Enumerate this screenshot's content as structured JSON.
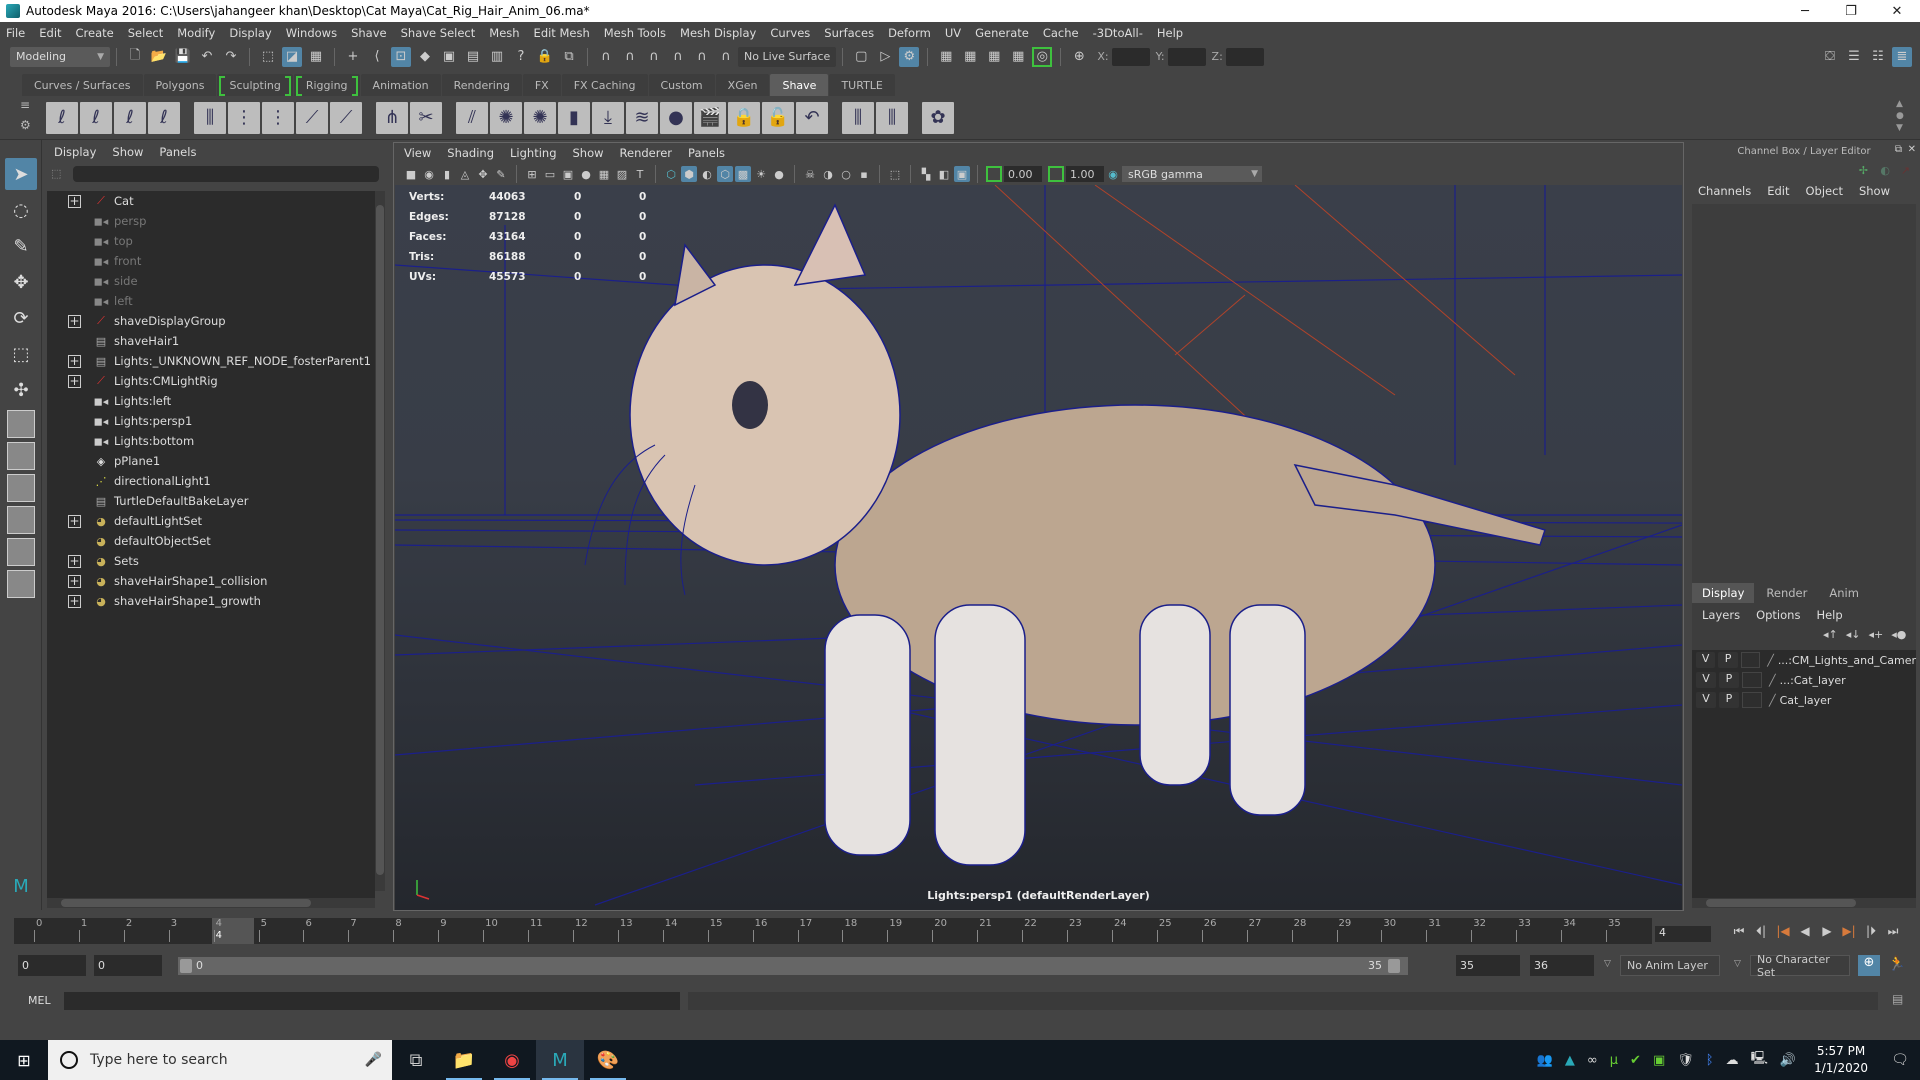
{
  "titlebar": {
    "title": "Autodesk Maya 2016: C:\\Users\\jahangeer khan\\Desktop\\Cat Maya\\Cat_Rig_Hair_Anim_06.ma*",
    "minimize": "─",
    "maximize": "❐",
    "close": "✕"
  },
  "menubar": [
    "File",
    "Edit",
    "Create",
    "Select",
    "Modify",
    "Display",
    "Windows",
    "Shave",
    "Shave Select",
    "Mesh",
    "Edit Mesh",
    "Mesh Tools",
    "Mesh Display",
    "Curves",
    "Surfaces",
    "Deform",
    "UV",
    "Generate",
    "Cache",
    "-3DtoAll-",
    "Help"
  ],
  "statusline": {
    "menuset": "Modeling",
    "live_surface": "No Live Surface",
    "x_label": "X:",
    "y_label": "Y:",
    "z_label": "Z:"
  },
  "shelf_tabs": [
    {
      "label": "Curves / Surfaces",
      "active": false,
      "bracketed": false
    },
    {
      "label": "Polygons",
      "active": false,
      "bracketed": false
    },
    {
      "label": "Sculpting",
      "active": false,
      "bracketed": true
    },
    {
      "label": "Rigging",
      "active": false,
      "bracketed": true
    },
    {
      "label": "Animation",
      "active": false,
      "bracketed": false
    },
    {
      "label": "Rendering",
      "active": false,
      "bracketed": false
    },
    {
      "label": "FX",
      "active": false,
      "bracketed": false
    },
    {
      "label": "FX Caching",
      "active": false,
      "bracketed": false
    },
    {
      "label": "Custom",
      "active": false,
      "bracketed": false
    },
    {
      "label": "XGen",
      "active": false,
      "bracketed": false
    },
    {
      "label": "Shave",
      "active": true,
      "bracketed": false
    },
    {
      "label": "TURTLE",
      "active": false,
      "bracketed": false
    }
  ],
  "shelf_icons": [
    "shave-curve-1",
    "shave-curve-2",
    "shave-curve-3",
    "shave-curve-4",
    "gap",
    "shave-guide-1",
    "shave-guide-2",
    "shave-guide-3",
    "shave-guide-4",
    "shave-guide-5",
    "gap",
    "comb",
    "cut-scissors",
    "gap",
    "hair-strands",
    "hair-ball-1",
    "hair-ball-2",
    "brush",
    "arrow-down",
    "wave",
    "fur-ball",
    "clapboard",
    "lock-closed",
    "lock-open",
    "undo-arrow",
    "gap",
    "hair-attr-1",
    "hair-attr-2",
    "gap",
    "shave-logo"
  ],
  "outliner": {
    "menu": [
      "Display",
      "Show",
      "Panels"
    ],
    "items": [
      {
        "label": "Cat",
        "icon": "transform",
        "expandable": true,
        "dim": false
      },
      {
        "label": "persp",
        "icon": "camera",
        "expandable": false,
        "dim": true
      },
      {
        "label": "top",
        "icon": "camera",
        "expandable": false,
        "dim": true
      },
      {
        "label": "front",
        "icon": "camera",
        "expandable": false,
        "dim": true
      },
      {
        "label": "side",
        "icon": "camera",
        "expandable": false,
        "dim": true
      },
      {
        "label": "left",
        "icon": "camera",
        "expandable": false,
        "dim": true
      },
      {
        "label": "shaveDisplayGroup",
        "icon": "transform",
        "expandable": true,
        "dim": false
      },
      {
        "label": "shaveHair1",
        "icon": "group",
        "expandable": false,
        "dim": false
      },
      {
        "label": "Lights:_UNKNOWN_REF_NODE_fosterParent1",
        "icon": "group",
        "expandable": true,
        "dim": false
      },
      {
        "label": "Lights:CMLightRig",
        "icon": "transform",
        "expandable": true,
        "dim": false
      },
      {
        "label": "Lights:left",
        "icon": "camera",
        "expandable": false,
        "dim": false
      },
      {
        "label": "Lights:persp1",
        "icon": "camera",
        "expandable": false,
        "dim": false
      },
      {
        "label": "Lights:bottom",
        "icon": "camera",
        "expandable": false,
        "dim": false
      },
      {
        "label": "pPlane1",
        "icon": "plane",
        "expandable": false,
        "dim": false
      },
      {
        "label": "directionalLight1",
        "icon": "light",
        "expandable": false,
        "dim": false
      },
      {
        "label": "TurtleDefaultBakeLayer",
        "icon": "group",
        "expandable": false,
        "dim": false
      },
      {
        "label": "defaultLightSet",
        "icon": "set",
        "expandable": true,
        "dim": false
      },
      {
        "label": "defaultObjectSet",
        "icon": "set",
        "expandable": false,
        "dim": false
      },
      {
        "label": "Sets",
        "icon": "set",
        "expandable": true,
        "dim": false
      },
      {
        "label": "shaveHairShape1_collision",
        "icon": "set",
        "expandable": true,
        "dim": false
      },
      {
        "label": "shaveHairShape1_growth",
        "icon": "set",
        "expandable": true,
        "dim": false
      }
    ]
  },
  "viewport": {
    "menu": [
      "View",
      "Shading",
      "Lighting",
      "Show",
      "Renderer",
      "Panels"
    ],
    "exposure": "0.00",
    "gamma": "1.00",
    "color_space": "sRGB gamma",
    "hud": [
      {
        "label": "Verts:",
        "value": "44063",
        "sel": "0",
        "comp": "0"
      },
      {
        "label": "Edges:",
        "value": "87128",
        "sel": "0",
        "comp": "0"
      },
      {
        "label": "Faces:",
        "value": "43164",
        "sel": "0",
        "comp": "0"
      },
      {
        "label": "Tris:",
        "value": "86188",
        "sel": "0",
        "comp": "0"
      },
      {
        "label": "UVs:",
        "value": "45573",
        "sel": "0",
        "comp": "0"
      }
    ],
    "camera_label": "Lights:persp1 (defaultRenderLayer)"
  },
  "channelbox": {
    "title": "Channel Box / Layer Editor",
    "menu": [
      "Channels",
      "Edit",
      "Object",
      "Show"
    ],
    "layer_tabs": [
      {
        "label": "Display",
        "active": true
      },
      {
        "label": "Render",
        "active": false
      },
      {
        "label": "Anim",
        "active": false
      }
    ],
    "layer_menu": [
      "Layers",
      "Options",
      "Help"
    ],
    "layers": [
      {
        "v": "V",
        "p": "P",
        "name": "...:CM_Lights_and_Camer"
      },
      {
        "v": "V",
        "p": "P",
        "name": "...:Cat_layer"
      },
      {
        "v": "V",
        "p": "P",
        "name": "Cat_layer"
      }
    ]
  },
  "timeline": {
    "start": 0,
    "end": 35,
    "current_frame": "4",
    "ticks": [
      "0",
      "1",
      "2",
      "3",
      "4",
      "5",
      "6",
      "7",
      "8",
      "9",
      "10",
      "11",
      "12",
      "13",
      "14",
      "15",
      "16",
      "17",
      "18",
      "19",
      "20",
      "21",
      "22",
      "23",
      "24",
      "25",
      "26",
      "27",
      "28",
      "29",
      "30",
      "31",
      "32",
      "33",
      "34",
      "35"
    ]
  },
  "range": {
    "anim_start": "0",
    "playback_start": "0",
    "range_start_label": "0",
    "range_end_label": "35",
    "playback_end": "35",
    "anim_end": "36",
    "anim_layer": "No Anim Layer",
    "character_set": "No Character Set"
  },
  "cmdline": {
    "label": "MEL"
  },
  "taskbar": {
    "search_placeholder": "Type here to search",
    "time": "5:57 PM",
    "date": "1/1/2020"
  }
}
